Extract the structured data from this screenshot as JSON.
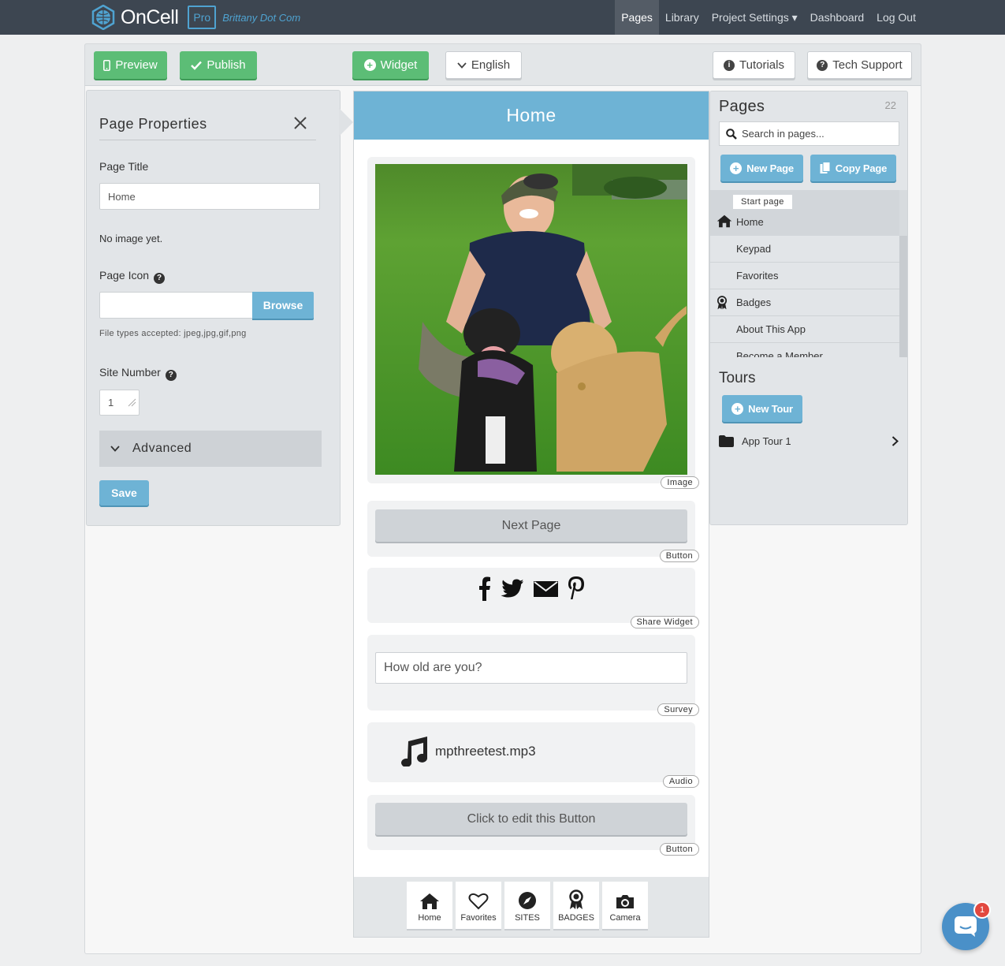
{
  "topnav": {
    "brand": "OnCell",
    "tier": "Pro",
    "account": "Brittany Dot Com",
    "items": [
      {
        "label": "Pages",
        "active": true
      },
      {
        "label": "Library",
        "active": false
      },
      {
        "label": "Project Settings ▾",
        "active": false
      },
      {
        "label": "Dashboard",
        "active": false
      },
      {
        "label": "Log Out",
        "active": false
      }
    ]
  },
  "toolbar": {
    "preview": "Preview",
    "publish": "Publish",
    "widget": "Widget",
    "language": "English",
    "tutorials": "Tutorials",
    "support": "Tech Support"
  },
  "page_properties": {
    "title": "Page Properties",
    "page_title_label": "Page Title",
    "page_title_value": "Home",
    "no_image": "No image yet.",
    "page_icon_label": "Page Icon",
    "browse": "Browse",
    "file_types": "File types accepted: jpeg,jpg,gif,png",
    "site_number_label": "Site Number",
    "site_number_value": "1",
    "advanced": "Advanced",
    "save": "Save"
  },
  "preview": {
    "header": "Home",
    "widgets": {
      "image_tag": "Image",
      "next_page_label": "Next Page",
      "button_tag": "Button",
      "share_tag": "Share Widget",
      "survey_question": "How old are you?",
      "survey_tag": "Survey",
      "audio_file": "mpthreetest.mp3",
      "audio_tag": "Audio",
      "edit_button_label": "Click to edit this Button",
      "button2_tag": "Button"
    },
    "tabs": [
      {
        "label": "Home",
        "icon": "home-icon"
      },
      {
        "label": "Favorites",
        "icon": "heart-icon"
      },
      {
        "label": "SITES",
        "icon": "compass-icon"
      },
      {
        "label": "BADGES",
        "icon": "badge-icon"
      },
      {
        "label": "Camera",
        "icon": "camera-icon"
      }
    ]
  },
  "pages_panel": {
    "title": "Pages",
    "count": "22",
    "search_placeholder": "Search in pages...",
    "new_page": "New Page",
    "copy_page": "Copy Page",
    "start_badge": "Start page",
    "items": [
      "Home",
      "Keypad",
      "Favorites",
      "Badges",
      "About This App",
      "Become a Member"
    ],
    "tours_title": "Tours",
    "new_tour": "New Tour",
    "tours": [
      "App Tour 1"
    ]
  },
  "chat": {
    "badge": "1"
  },
  "colors": {
    "accent_blue": "#6eb3d5",
    "green": "#5cbd76",
    "nav_dark": "#3d4651"
  }
}
